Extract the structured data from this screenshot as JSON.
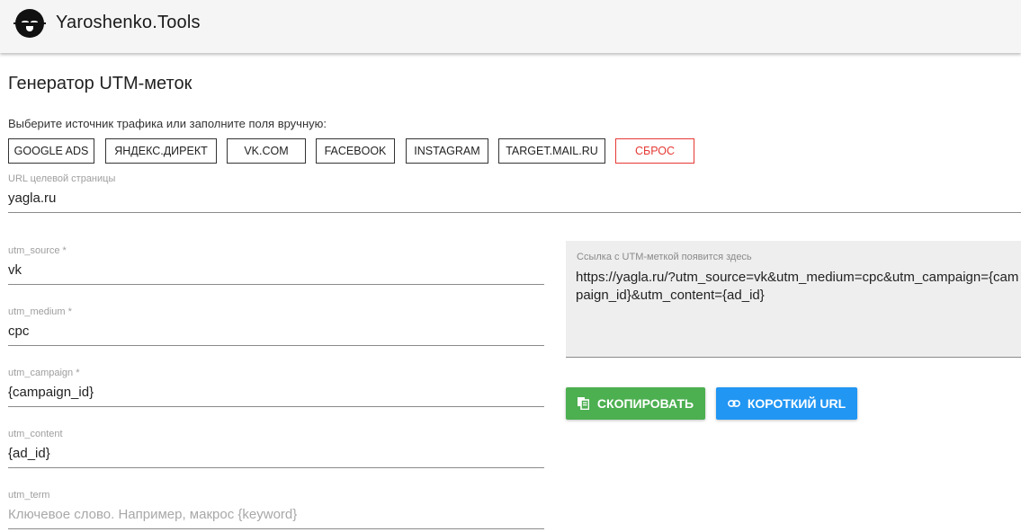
{
  "header": {
    "brand": "Yaroshenko.Tools",
    "logo_icon": "sleepy-face-logo-icon"
  },
  "page": {
    "title": "Генератор UTM-меток",
    "hint": "Выберите источник трафика или заполните поля вручную:"
  },
  "sources": {
    "google": "GOOGLE ADS",
    "yandex": "ЯНДЕКС.ДИРЕКТ",
    "vk": "VK.COM",
    "facebook": "FACEBOOK",
    "instagram": "INSTAGRAM",
    "target": "TARGET.MAIL.RU",
    "reset": "СБРОС"
  },
  "fields": {
    "url": {
      "label": "URL целевой страницы",
      "value": "yagla.ru"
    },
    "source": {
      "label": "utm_source *",
      "value": "vk"
    },
    "medium": {
      "label": "utm_medium *",
      "value": "cpc"
    },
    "campaign": {
      "label": "utm_campaign *",
      "value": "{campaign_id}"
    },
    "content": {
      "label": "utm_content",
      "value": "{ad_id}"
    },
    "term": {
      "label": "utm_term",
      "value": "",
      "placeholder": "Ключевое слово. Например, макрос {keyword}"
    }
  },
  "result": {
    "label": "Ссылка с UTM-меткой появится здесь",
    "text": "https://yagla.ru/?utm_source=vk&utm_medium=cpc&utm_campaign={campaign_id}&utm_content={ad_id}"
  },
  "actions": {
    "copy": "СКОПИРОВАТЬ",
    "short": "КОРОТКИЙ URL"
  },
  "colors": {
    "copy_button": "#4caf50",
    "short_button": "#2196f3",
    "reset": "#e53935"
  }
}
